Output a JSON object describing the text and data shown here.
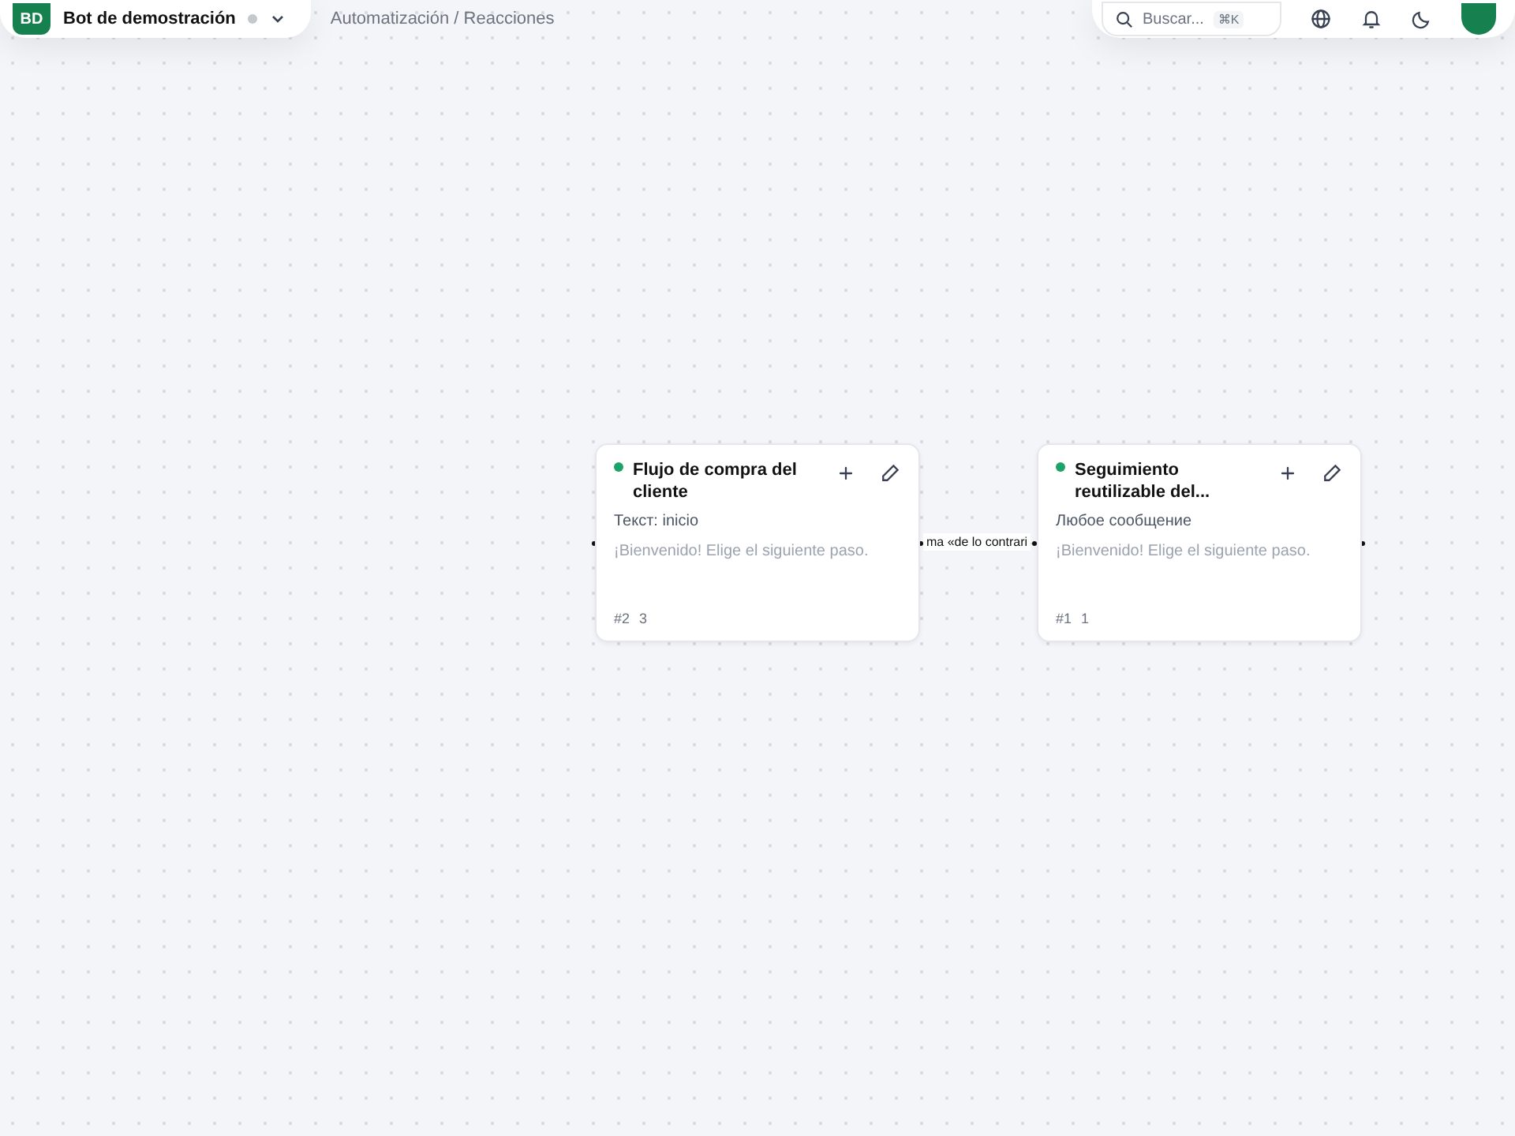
{
  "workspace": {
    "initials": "BD",
    "name": "Bot de demostración"
  },
  "breadcrumb": "Automatización / Reacciones",
  "search": {
    "placeholder": "Buscar...",
    "shortcut": "⌘K"
  },
  "nodes": [
    {
      "title": "Flujo de compra del cliente",
      "trigger": "Текст: inicio",
      "message": "¡Bienvenido! Elige el siguiente paso.",
      "id": "#2",
      "count": "3",
      "active": true
    },
    {
      "title": "Seguimiento reutilizable del...",
      "trigger": "Любое сообщение",
      "message": "¡Bienvenido! Elige el siguiente paso.",
      "id": "#1",
      "count": "1",
      "active": true
    }
  ],
  "edges": [
    {
      "label": "ma «de lo contrari"
    }
  ]
}
